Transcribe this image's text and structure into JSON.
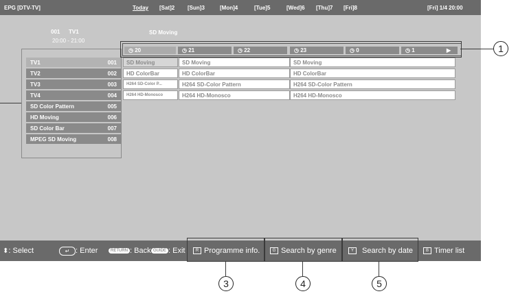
{
  "topbar": {
    "title": "EPG [DTV-TV]",
    "days": [
      {
        "label": "Today"
      },
      {
        "label": "[Sat]2"
      },
      {
        "label": "[Sun]3"
      },
      {
        "label": "[Mon]4"
      },
      {
        "label": "[Tue]5"
      },
      {
        "label": "[Wed]6"
      },
      {
        "label": "[Thu]7"
      },
      {
        "label": "[Fri]8"
      }
    ],
    "datetime": "[Fri] 1/4 20:00"
  },
  "info": {
    "channel_number": "001",
    "channel_name": "TV1",
    "time_range": "20:00 - 21:00",
    "programme": "SD Moving"
  },
  "timeline": {
    "slots": [
      "20",
      "21",
      "22",
      "23",
      "0",
      "1"
    ],
    "next_arrow": "▶"
  },
  "channels": [
    {
      "name": "TV1",
      "number": "001"
    },
    {
      "name": "TV2",
      "number": "002"
    },
    {
      "name": "TV3",
      "number": "003"
    },
    {
      "name": "TV4",
      "number": "004"
    },
    {
      "name": "SD Color Pattern",
      "number": "005"
    },
    {
      "name": "HD Moving",
      "number": "006"
    },
    {
      "name": "SD Color Bar",
      "number": "007"
    },
    {
      "name": "MPEG SD Moving",
      "number": "008"
    }
  ],
  "programmes": {
    "row1": [
      "SD Moving",
      "SD Moving",
      "SD Moving"
    ],
    "row2": [
      "HD ColorBar",
      "HD ColorBar",
      "HD ColorBar"
    ],
    "row3": [
      "H264 SD-Color P...",
      "H264 SD-Color Pattern",
      "H264 SD-Color Pattern"
    ],
    "row4": [
      "H264 HD-Monosco",
      "H264 HD-Monosco",
      "H264 HD-Monosco"
    ]
  },
  "bottombar": {
    "select": ": Select",
    "enter": ": Enter",
    "return_key": "RETURN",
    "back": ": Back",
    "guide_key": "GUIDE",
    "exit": ": Exit",
    "red_key": "R",
    "programme_info": "Programme info.",
    "green_key": "G",
    "search_genre": "Search by genre",
    "yellow_key": "Y",
    "search_date": "Search by date",
    "blue_key": "B",
    "timer_list": "Timer list"
  },
  "callouts": [
    "1",
    "3",
    "4",
    "5"
  ]
}
